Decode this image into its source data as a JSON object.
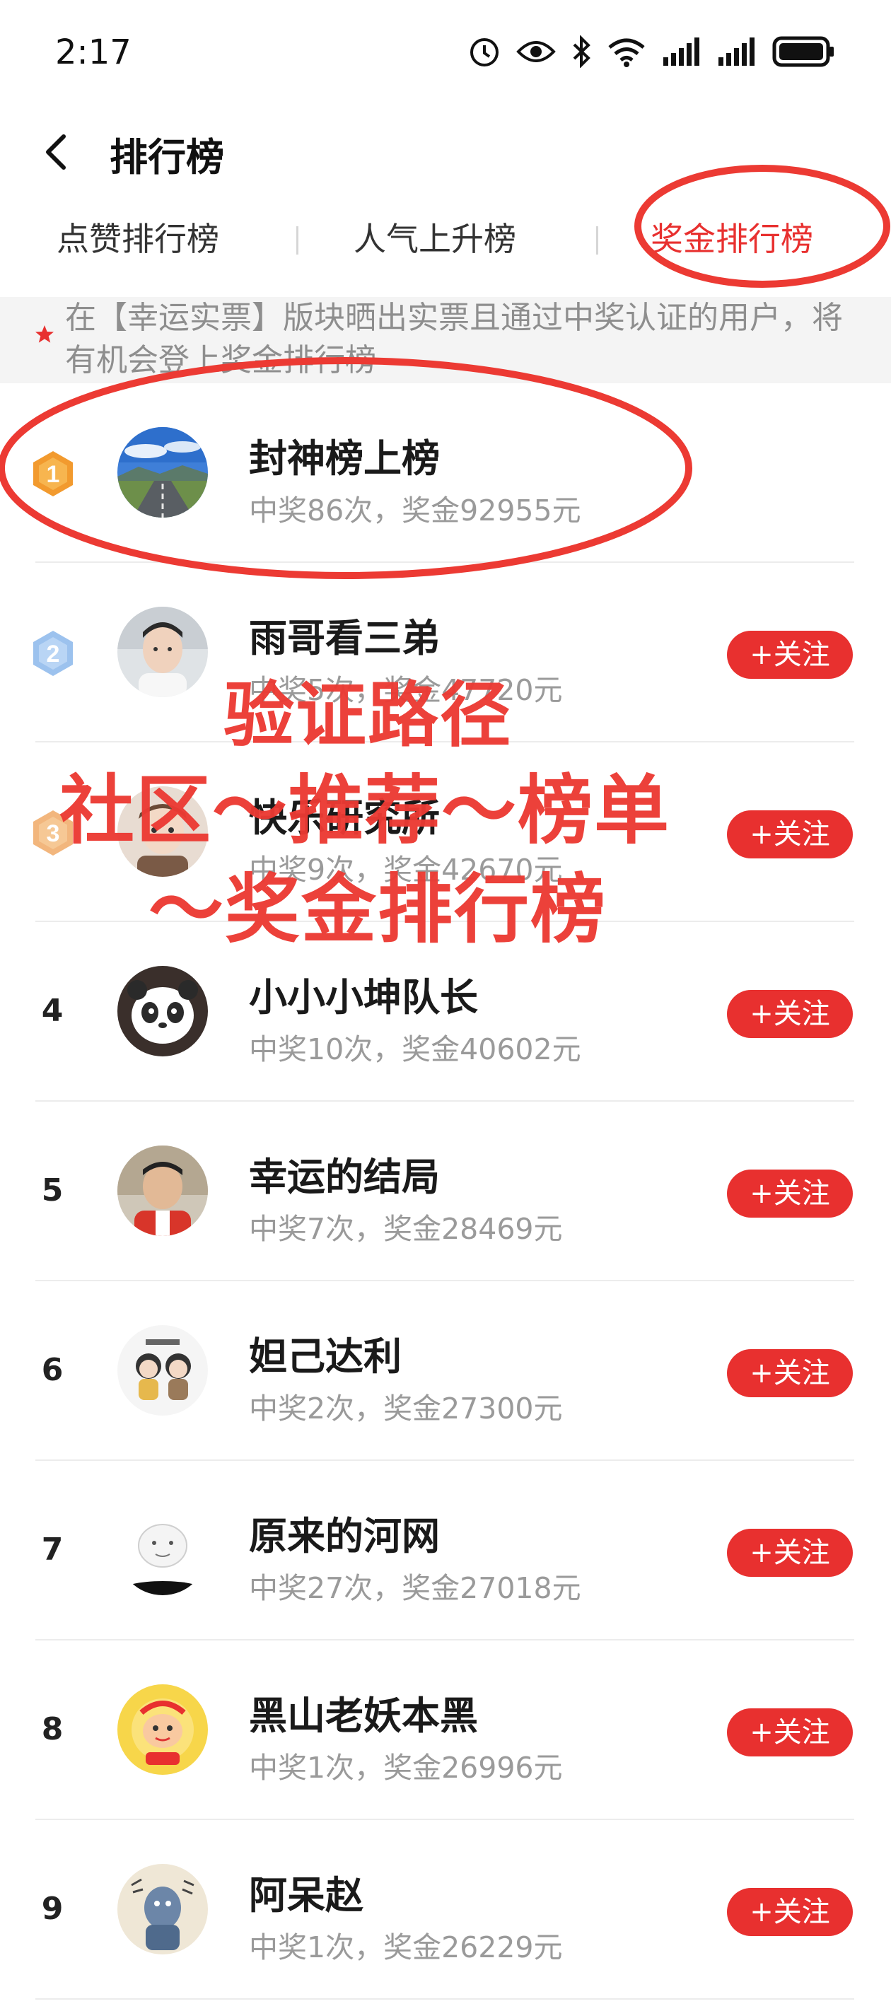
{
  "status_bar": {
    "time": "2:17",
    "icons": [
      "alarm-icon",
      "eye-icon",
      "bluetooth-icon",
      "wifi-icon",
      "signal-icon",
      "signal-icon",
      "battery-icon"
    ]
  },
  "header": {
    "title": "排行榜",
    "back_icon": "back-arrow-icon"
  },
  "tabs": [
    {
      "label": "点赞排行榜",
      "active": false
    },
    {
      "label": "人气上升榜",
      "active": false
    },
    {
      "label": "奖金排行榜",
      "active": true
    }
  ],
  "notice": {
    "text": "在【幸运实票】版块晒出实票且通过中奖认证的用户，将有机会登上奖金排行榜"
  },
  "follow_label": "+关注",
  "ranks": [
    {
      "rank": "1",
      "name": "封神榜上榜",
      "stats": "中奖86次，奖金92955元",
      "badge": "gold",
      "follow": false
    },
    {
      "rank": "2",
      "name": "雨哥看三弟",
      "stats": "中奖5次，奖金47720元",
      "badge": "silver",
      "follow": true
    },
    {
      "rank": "3",
      "name": "快乐研究所",
      "stats": "中奖9次，奖金42670元",
      "badge": "bronze",
      "follow": true
    },
    {
      "rank": "4",
      "name": "小小小坤队长",
      "stats": "中奖10次，奖金40602元",
      "badge": "",
      "follow": true
    },
    {
      "rank": "5",
      "name": "幸运的结局",
      "stats": "中奖7次，奖金28469元",
      "badge": "",
      "follow": true
    },
    {
      "rank": "6",
      "name": "妲己达利",
      "stats": "中奖2次，奖金27300元",
      "badge": "",
      "follow": true
    },
    {
      "rank": "7",
      "name": "原来的河网",
      "stats": "中奖27次，奖金27018元",
      "badge": "",
      "follow": true
    },
    {
      "rank": "8",
      "name": "黑山老妖本黑",
      "stats": "中奖1次，奖金26996元",
      "badge": "",
      "follow": true
    },
    {
      "rank": "9",
      "name": "阿呆赵",
      "stats": "中奖1次，奖金26229元",
      "badge": "",
      "follow": true
    }
  ],
  "annotations": {
    "line1": "验证路径",
    "line2": "社区～推荐～榜单",
    "line3": "～奖金排行榜"
  },
  "colors": {
    "accent": "#e8302f",
    "annotation": "#ec3a33",
    "gold": "#f29a2e",
    "silver": "#9cc2ee",
    "bronze": "#f2b67d"
  }
}
